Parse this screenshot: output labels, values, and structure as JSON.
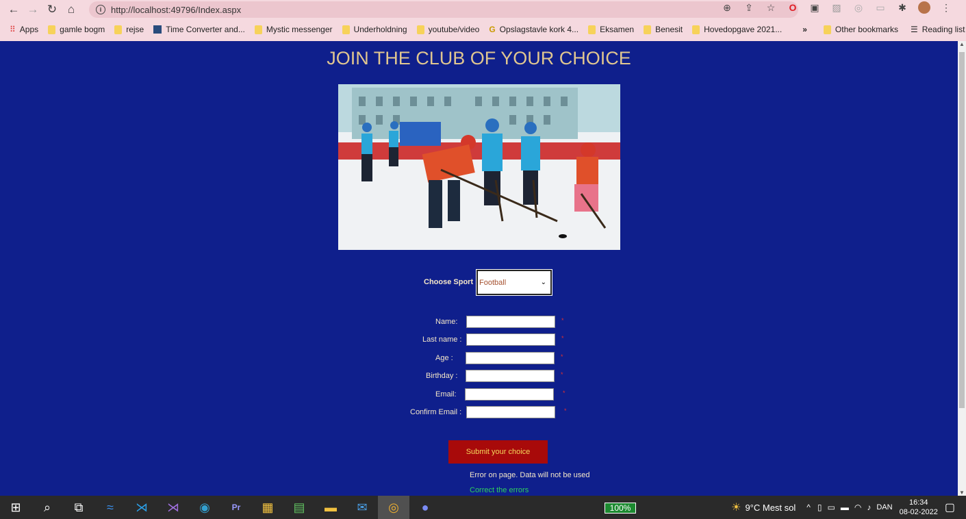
{
  "browser": {
    "url": "http://localhost:49796/Index.aspx",
    "bookmarks": [
      "Apps",
      "gamle bogm",
      "rejse",
      "Time Converter and...",
      "Mystic messenger",
      "Underholdning",
      "youtube/video",
      "Opslagstavle kork 4...",
      "Eksamen",
      "Benesit",
      "Hovedopgave 2021..."
    ],
    "overflow": "»",
    "other_bookmarks": "Other bookmarks",
    "reading_list": "Reading list"
  },
  "page": {
    "heading": "JOIN THE CLUB OF YOUR CHOICE",
    "sport_label": "Choose Sport",
    "sport_selected": "Football",
    "fields": [
      {
        "label": "Name:",
        "required": "*"
      },
      {
        "label": "Last name :",
        "required": "*"
      },
      {
        "label": "Age :",
        "required": "*"
      },
      {
        "label": "Birthday :",
        "required": "*"
      },
      {
        "label": "Email:",
        "required": "*"
      },
      {
        "label": "Confirm Email :",
        "required": "*"
      }
    ],
    "submit_label": "Submit your choice",
    "error_text": "Error on page. Data will not be used",
    "correct_text": "Correct the errors"
  },
  "taskbar": {
    "battery": "100%",
    "weather": "9°C  Mest sol",
    "language": "DAN",
    "time": "16:34",
    "date": "08-02-2022"
  }
}
